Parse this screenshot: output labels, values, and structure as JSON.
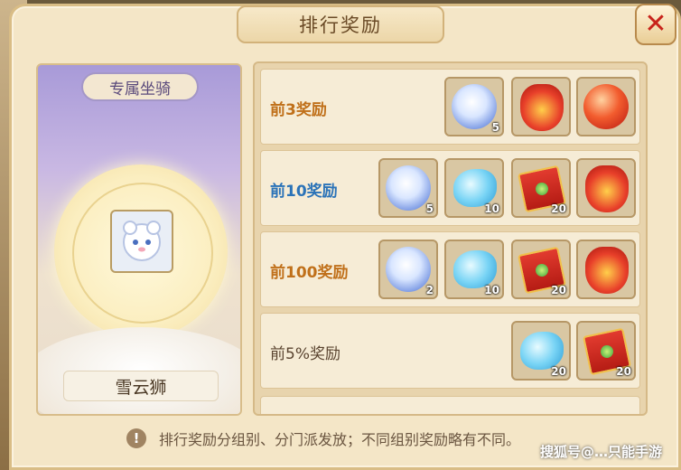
{
  "window": {
    "title": "排行奖励",
    "close_label": "✕"
  },
  "mount": {
    "header": "专属坐骑",
    "name": "雪云狮"
  },
  "rewards": [
    {
      "label": "前3奖励",
      "items": [
        {
          "icon": "snow-lion-orb-icon",
          "count": "5"
        },
        {
          "icon": "gold-red-pouch-icon",
          "count": ""
        },
        {
          "icon": "red-fire-orb-icon",
          "count": ""
        }
      ]
    },
    {
      "label": "前10奖励",
      "items": [
        {
          "icon": "snow-lion-orb-icon",
          "count": "5"
        },
        {
          "icon": "blue-spirit-wisp-icon",
          "count": "10"
        },
        {
          "icon": "red-envelope-icon",
          "count": "20"
        },
        {
          "icon": "gold-red-pouch-icon",
          "count": ""
        }
      ]
    },
    {
      "label": "前100奖励",
      "items": [
        {
          "icon": "snow-lion-orb-icon",
          "count": "2"
        },
        {
          "icon": "blue-spirit-wisp-icon",
          "count": "10"
        },
        {
          "icon": "red-envelope-icon",
          "count": "20"
        },
        {
          "icon": "red-lucky-bag-icon",
          "count": ""
        }
      ]
    },
    {
      "label": "前5%奖励",
      "items": [
        {
          "icon": "blue-spirit-wisp-icon",
          "count": "20"
        },
        {
          "icon": "red-envelope-icon",
          "count": "20"
        }
      ]
    }
  ],
  "notice": {
    "icon": "!",
    "text": "排行奖励分组别、分门派发放；不同组别奖励略有不同。"
  },
  "watermark": "搜狐号@…只能手游"
}
